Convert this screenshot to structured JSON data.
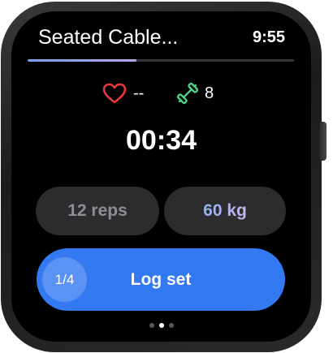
{
  "header": {
    "title": "Seated Cable...",
    "time": "9:55"
  },
  "progress": {
    "fraction": 0.41,
    "fill_color_start": "#7a9ff0",
    "fill_color_end": "#b7a7e8"
  },
  "stats": {
    "heart_rate": "--",
    "heart_icon": "heart-icon",
    "heart_color": "#e8383d",
    "sets": "8",
    "sets_icon": "dumbbell-icon",
    "sets_color": "#4fd487"
  },
  "timer": "00:34",
  "controls": {
    "reps_label": "12 reps",
    "weight_label": "60 kg"
  },
  "log_button": {
    "set_counter": "1/4",
    "label": "Log set",
    "color": "#3279f2"
  },
  "page_indicator": {
    "count": 3,
    "active_index": 1
  }
}
